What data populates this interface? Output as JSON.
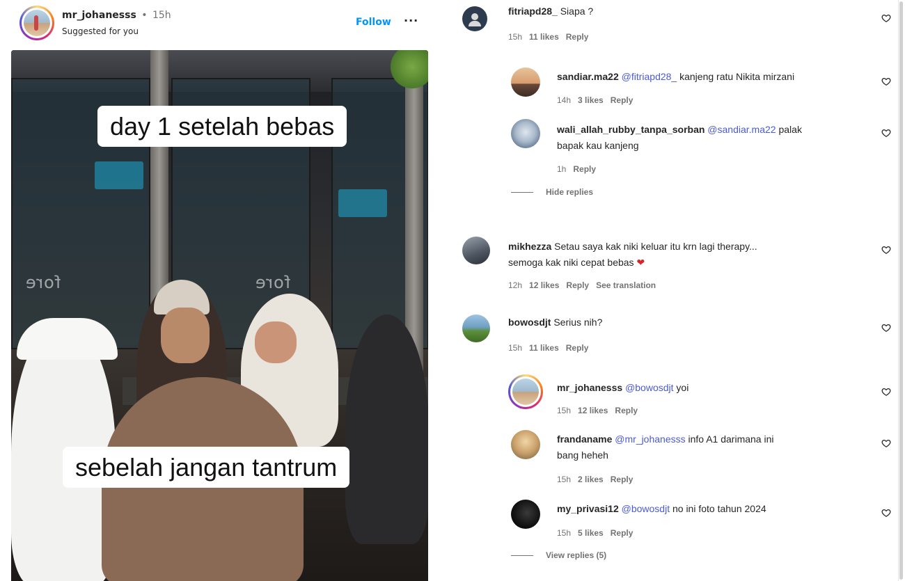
{
  "post": {
    "username": "mr_johanesss",
    "separator": "•",
    "time": "15h",
    "subtitle": "Suggested for you",
    "follow_label": "Follow",
    "more_label": "···",
    "caption_top": "day 1 setelah bebas",
    "caption_bottom": "sebelah jangan tantrum",
    "watermark": "fore"
  },
  "comments": [
    {
      "user": "fitriapd28_",
      "mention": "",
      "text": "Siapa ?",
      "time": "15h",
      "likes": "11 likes",
      "reply": "Reply"
    },
    {
      "user": "sandiar.ma22",
      "mention": "@fitriapd28_",
      "text": "kanjeng ratu Nikita mirzani",
      "time": "14h",
      "likes": "3 likes",
      "reply": "Reply"
    },
    {
      "user": "wali_allah_rubby_tanpa_sorban",
      "mention": "@sandiar.ma22",
      "text_line1": "palak",
      "text_line2": "bapak kau kanjeng",
      "time": "1h",
      "reply": "Reply"
    },
    {
      "user": "mikhezza",
      "text_line1": "Setau saya kak niki keluar itu krn lagi therapy...",
      "text_line2": "semoga kak niki cepat bebas",
      "emoji": "❤",
      "time": "12h",
      "likes": "12 likes",
      "reply": "Reply",
      "translate": "See translation"
    },
    {
      "user": "bowosdjt",
      "text": "Serius nih?",
      "time": "15h",
      "likes": "11 likes",
      "reply": "Reply"
    },
    {
      "user": "mr_johanesss",
      "mention": "@bowosdjt",
      "text": "yoi",
      "time": "15h",
      "likes": "12 likes",
      "reply": "Reply"
    },
    {
      "user": "frandaname",
      "mention": "@mr_johanesss",
      "text_line1": "info A1 darimana ini",
      "text_line2": "bang heheh",
      "time": "15h",
      "likes": "2 likes",
      "reply": "Reply"
    },
    {
      "user": "my_privasi12",
      "mention": "@bowosdjt",
      "text": "no ini foto tahun 2024",
      "time": "15h",
      "likes": "5 likes",
      "reply": "Reply"
    }
  ],
  "hide_replies": "Hide replies",
  "view_replies": "View replies (5)",
  "colors": {
    "accent": "#0095f6",
    "mention": "#4a5bd4",
    "heart": "#d62728",
    "meta": "#737373"
  },
  "icons": {
    "like": "heart-outline-icon",
    "more": "more-horizontal-icon"
  }
}
